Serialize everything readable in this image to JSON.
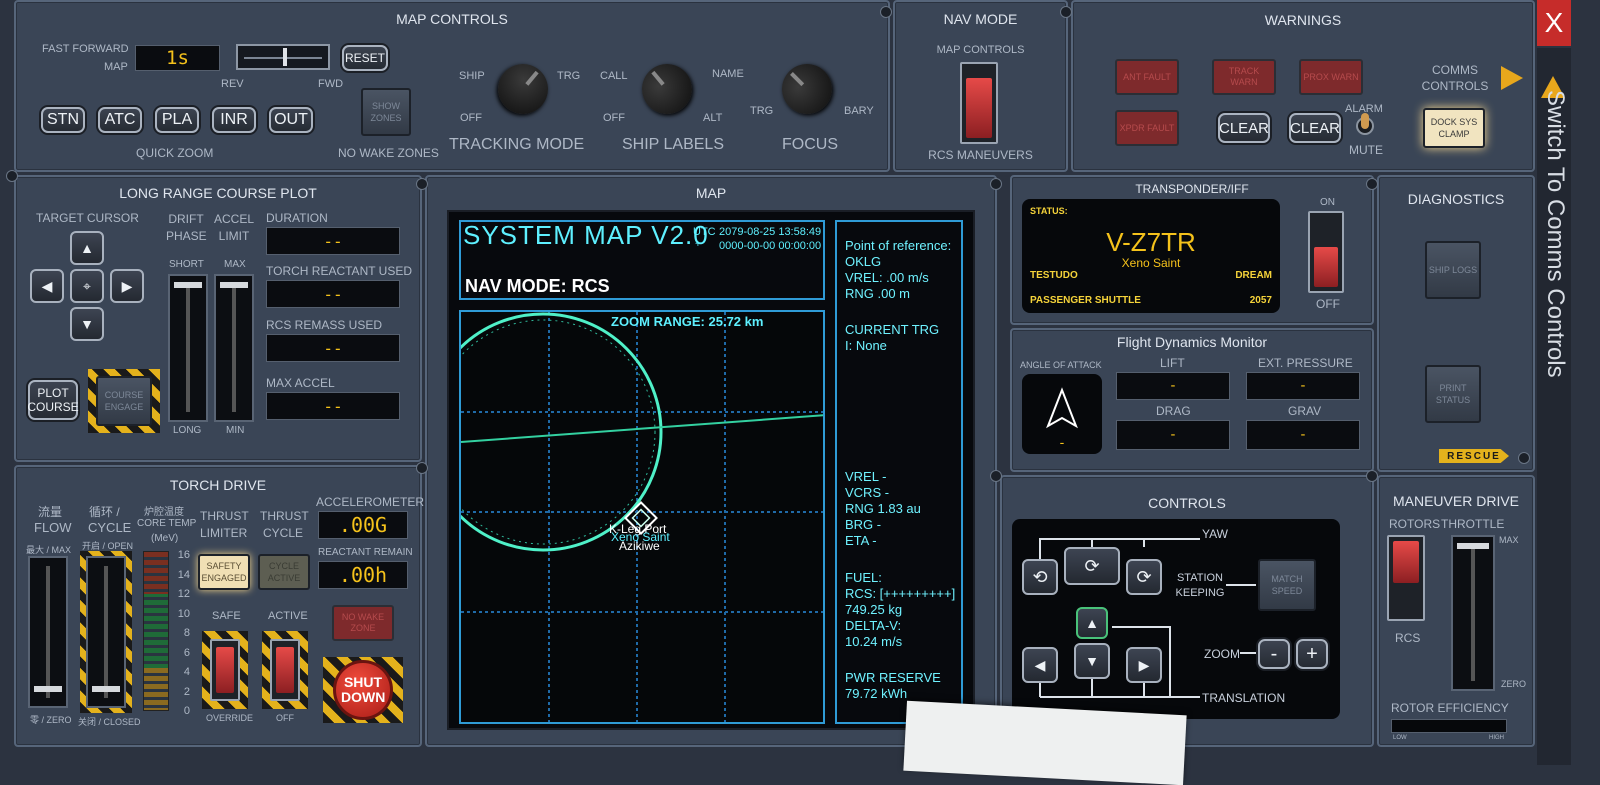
{
  "map_controls": {
    "title": "MAP CONTROLS",
    "fast_forward_label": "FAST FORWARD",
    "map_label": "MAP",
    "time_value": "1s",
    "rev_label": "REV",
    "fwd_label": "FWD",
    "reset_label": "RESET",
    "quick_zoom_buttons": [
      "STN",
      "ATC",
      "PLA",
      "INR",
      "OUT"
    ],
    "quick_zoom_label": "QUICK ZOOM",
    "show_zones_label": "SHOW ZONES",
    "no_wake_zones_label": "NO WAKE ZONES",
    "tracking": {
      "left_top": "SHIP",
      "right_top": "TRG",
      "left_bottom": "OFF",
      "title": "TRACKING MODE"
    },
    "ship_labels": {
      "left_top": "CALL",
      "right_top": "NAME",
      "left_bottom": "OFF",
      "right_bottom": "ALT",
      "title": "SHIP LABELS"
    },
    "focus": {
      "left": "TRG",
      "right": "BARY",
      "title": "FOCUS"
    }
  },
  "nav_mode": {
    "title": "NAV MODE",
    "top_label": "MAP CONTROLS",
    "bottom_label": "RCS MANEUVERS"
  },
  "warnings": {
    "title": "WARNINGS",
    "lights": [
      "ANT FAULT",
      "TRACK WARN",
      "PROX WARN",
      "XPDR FAULT"
    ],
    "clear_labels": [
      "CLEAR",
      "CLEAR"
    ],
    "alarm_label": "ALARM",
    "mute_label": "MUTE",
    "comms_controls_label": "COMMS CONTROLS",
    "dock_sys_label": "DOCK SYS CLAMP"
  },
  "close_label": "X",
  "side_tab_label": "Switch To Comms Controls",
  "course_plot": {
    "title": "LONG RANGE COURSE PLOT",
    "target_cursor_label": "TARGET CURSOR",
    "drift_phase_label": "DRIFT PHASE",
    "accel_limit_label": "ACCEL LIMIT",
    "short_label": "SHORT",
    "long_label": "LONG",
    "max_label": "MAX",
    "min_label": "MIN",
    "plot_course_label": "PLOT COURSE",
    "course_engage_label": "COURSE ENGAGE",
    "readouts": [
      {
        "label": "DURATION",
        "value": "--"
      },
      {
        "label": "TORCH REACTANT USED",
        "value": "--"
      },
      {
        "label": "RCS REMASS USED",
        "value": "--"
      },
      {
        "label": "MAX ACCEL",
        "value": "--"
      }
    ]
  },
  "torch": {
    "title": "TORCH DRIVE",
    "flow_cn": "流量",
    "flow": "FLOW",
    "cycle_cn": "循环 /",
    "cycle": "CYCLE",
    "core_temp_cn": "炉腔温度",
    "core_temp": "CORE TEMP",
    "mev": "(MeV)",
    "max_cn": "最大 / MAX",
    "open_cn": "开启 / OPEN",
    "zero_cn": "零 / ZERO",
    "closed_cn": "关闭 / CLOSED",
    "temp_scale": [
      "16",
      "14",
      "12",
      "10",
      "8",
      "6",
      "4",
      "2",
      "0"
    ],
    "thrust_limiter": "THRUST LIMITER",
    "thrust_cycle": "THRUST CYCLE",
    "safety_engaged": "SAFETY ENGAGED",
    "cycle_active": "CYCLE ACTIVE",
    "safe": "SAFE",
    "active": "ACTIVE",
    "override": "OVERRIDE",
    "off": "OFF",
    "accelerometer": "ACCELEROMETER",
    "accel_value": ".00G",
    "reactant_remain": "REACTANT REMAIN",
    "reactant_value": ".00h",
    "no_wake_zone": "NO WAKE ZONE",
    "shutdown": "SHUT DOWN"
  },
  "map": {
    "title": "MAP",
    "system_title": "SYSTEM MAP V2.0",
    "utc_label": "UTC",
    "utc_time": "2079-08-25 13:58:49",
    "utc_plus": "+",
    "elapsed": "0000-00-00 00:00:00",
    "nav_mode": "NAV MODE: RCS",
    "zoom_range": "ZOOM RANGE: 25.72 km",
    "marker_label1": "K-Leg Port",
    "marker_label2": "Xeno Saint",
    "marker_label3": "Azikiwe",
    "side_top": [
      "Point of reference:",
      "OKLG",
      "VREL: .00 m/s",
      "RNG .00 m"
    ],
    "side_trg": [
      "CURRENT TRG",
      "I: None"
    ],
    "side_mid": [
      "VREL -",
      "VCRS -",
      "RNG 1.83 au",
      "BRG -",
      "ETA -"
    ],
    "side_fuel": [
      "FUEL:",
      "RCS: [+++++++++]",
      "749.25 kg",
      "DELTA-V:",
      "10.24 m/s"
    ],
    "side_pwr": [
      "PWR RESERVE",
      "79.72 kWh"
    ]
  },
  "transponder": {
    "title": "TRANSPONDER/IFF",
    "status_label": "STATUS:",
    "callsign": "V-Z7TR",
    "ship_name": "Xeno Saint",
    "left_tag": "TESTUDO",
    "right_tag": "DREAM",
    "type": "PASSENGER SHUTTLE",
    "year": "2057",
    "on_label": "ON",
    "off_label": "OFF"
  },
  "diagnostics": {
    "title": "DIAGNOSTICS",
    "ship_logs": "SHIP LOGS",
    "print_status": "PRINT STATUS",
    "rescue": "RESCUE"
  },
  "flight_dynamics": {
    "title": "Flight Dynamics Monitor",
    "aoa_label": "ANGLE OF ATTACK",
    "aoa_value": "-",
    "lift_label": "LIFT",
    "lift_value": "-",
    "ext_pressure_label": "EXT. PRESSURE",
    "ext_pressure_value": "-",
    "drag_label": "DRAG",
    "drag_value": "-",
    "grav_label": "GRAV",
    "grav_value": "-"
  },
  "controls": {
    "title": "CONTROLS",
    "yaw": "YAW",
    "station_keeping": "STATION KEEPING",
    "match_speed": "MATCH SPEED",
    "zoom": "ZOOM",
    "minus": "-",
    "plus": "+",
    "translation": "TRANSLATION"
  },
  "maneuver": {
    "title": "MANEUVER DRIVE",
    "rotors": "ROTORS",
    "throttle": "THROTTLE",
    "max": "MAX",
    "zero": "ZERO",
    "rcs": "RCS",
    "rotor_efficiency": "ROTOR EFFICIENCY",
    "low": "LOW",
    "high": "HIGH"
  }
}
